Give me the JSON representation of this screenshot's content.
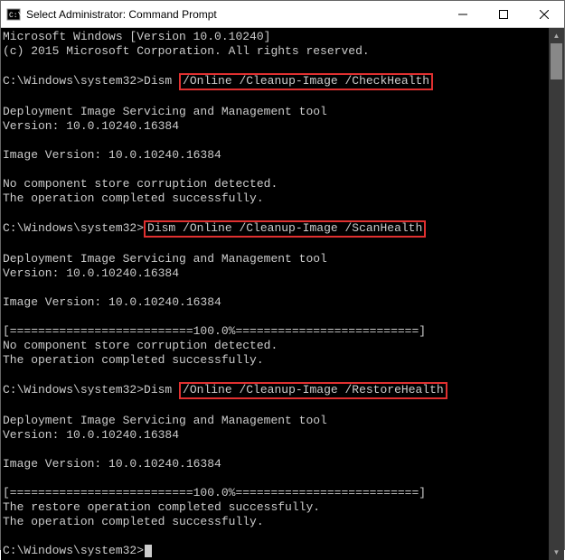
{
  "window": {
    "title": "Select Administrator: Command Prompt"
  },
  "term": {
    "line_ver": "Microsoft Windows [Version 10.0.10240]",
    "line_copy": "(c) 2015 Microsoft Corporation. All rights reserved.",
    "prompt": "C:\\Windows\\system32>",
    "dism": "Dism ",
    "hl1": "/Online /Cleanup-Image /CheckHealth",
    "hl2": "Dism /Online /Cleanup-Image /ScanHealth",
    "hl3": "/Online /Cleanup-Image /RestoreHealth",
    "tool_line": "Deployment Image Servicing and Management tool",
    "tool_ver": "Version: 10.0.10240.16384",
    "img_ver": "Image Version: 10.0.10240.16384",
    "no_corrupt": "No component store corruption detected.",
    "op_success": "The operation completed successfully.",
    "progress": "[==========================100.0%==========================]",
    "restore_success": "The restore operation completed successfully."
  }
}
